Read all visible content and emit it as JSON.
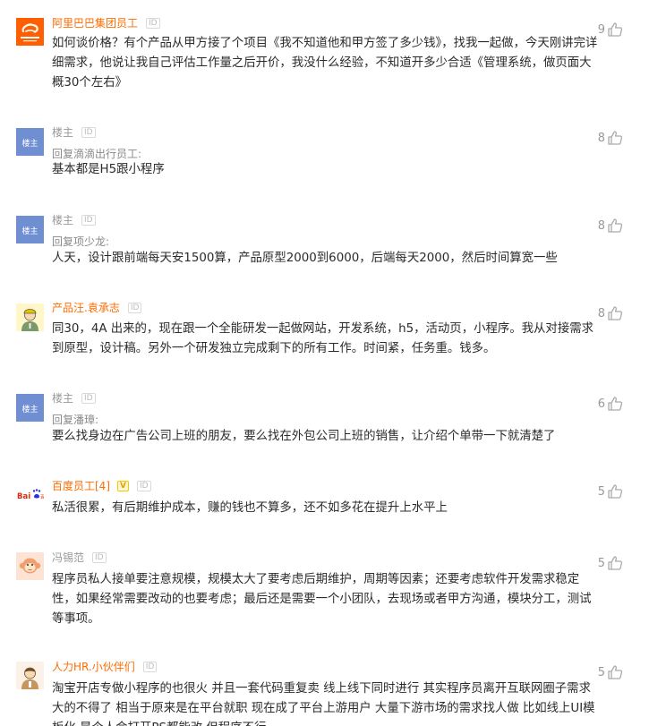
{
  "comments": [
    {
      "user": "阿里巴巴集团员工",
      "id_tag": "ID",
      "avatar": "alibaba-logo",
      "body": "如何谈价格？有个产品从甲方接了个项目《我不知道他和甲方签了多少钱》，找我一起做，今天刚讲完详细需求，他说让我自己评估工作量之后开价，我没什么经验，不知道开多少合适《管理系统，做页面大概30个左右》",
      "likes": "9"
    },
    {
      "user": "楼主",
      "id_tag": "ID",
      "avatar": "楼主",
      "reply_to": "回复滴滴出行员工:",
      "body": "基本都是H5跟小程序",
      "likes": "8"
    },
    {
      "user": "楼主",
      "id_tag": "ID",
      "avatar": "楼主",
      "reply_to": "回复项少龙:",
      "body": "人天，设计跟前端每天安1500算，产品原型2000到6000，后端每天2000，然后时间算宽一些",
      "likes": "8"
    },
    {
      "user": "产品汪.袁承志",
      "id_tag": "ID",
      "avatar": "worker-cartoon",
      "body": "同30，4A 出来的，现在跟一个全能研发一起做网站，开发系统，h5，活动页，小程序。我从对接需求到原型，设计稿。另外一个研发独立完成剩下的所有工作。时间紧，任务重。钱多。",
      "likes": "8"
    },
    {
      "user": "楼主",
      "id_tag": "ID",
      "avatar": "楼主",
      "reply_to": "回复潘璋:",
      "body": "要么找身边在广告公司上班的朋友，要么找在外包公司上班的销售，让介绍个单带一下就清楚了",
      "likes": "6"
    },
    {
      "user": "百度员工[4]",
      "v_tag": "V",
      "id_tag": "ID",
      "avatar": "baidu-logo",
      "body": "私活很累，有后期维护成本，赚的钱也不算多，还不如多花在提升上水平上",
      "likes": "5"
    },
    {
      "user": "冯锡范",
      "id_tag": "ID",
      "avatar": "monkey-cartoon",
      "body": "程序员私人接单要注意规模，规模太大了要考虑后期维护，周期等因素；还要考虑软件开发需求稳定性，如果经常需要改动的也要考虑；最后还是需要一个小团队，去现场或者甲方沟通，模块分工，测试等事项。",
      "likes": "5"
    },
    {
      "user": "人力HR.小伙伴们",
      "id_tag": "ID",
      "avatar": "hr-cartoon",
      "body": "淘宝开店专做小程序的也很火 并且一套代码重复卖 线上线下同时进行 其实程序员离开互联网圈子需求大的不得了 相当于原来是在平台就职 现在成了平台上游用户 大量下游市场的需求找人做 比如线上UI模板化 是个人会打开PS都能改 但程序不行",
      "likes": "5"
    }
  ],
  "colors": {
    "brand_orange": "#ff6b00",
    "louzhu_avatar": "#6f8fd2",
    "text_gray": "#999999"
  }
}
